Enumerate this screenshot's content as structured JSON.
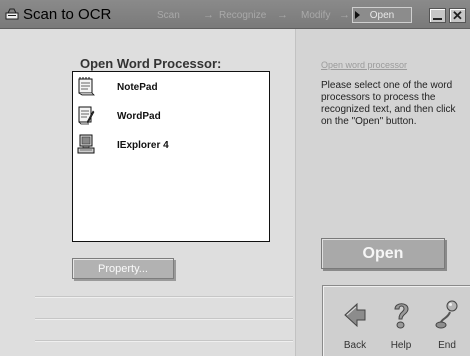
{
  "window": {
    "title": "Scan to OCR"
  },
  "steps": {
    "scan": "Scan",
    "recognize": "Recognize",
    "modify": "Modify",
    "open": "Open",
    "arrow": "→"
  },
  "list": {
    "heading": "Open Word Processor:",
    "items": [
      {
        "label": "NotePad",
        "icon": "notepad-icon"
      },
      {
        "label": "WordPad",
        "icon": "wordpad-icon"
      },
      {
        "label": "IExplorer 4",
        "icon": "computer-icon"
      }
    ]
  },
  "buttons": {
    "property": "Property...",
    "open": "Open"
  },
  "help": {
    "link": "Open word processor",
    "text": "Please select one of the word processors to process the recognized text, and then click on the \"Open\" button."
  },
  "nav": {
    "back": "Back",
    "help": "Help",
    "end": "End"
  },
  "colors": {
    "titlebar": "#7f7f7f",
    "open_button": "#a9a9a9",
    "property_button": "#b2b2b2"
  }
}
